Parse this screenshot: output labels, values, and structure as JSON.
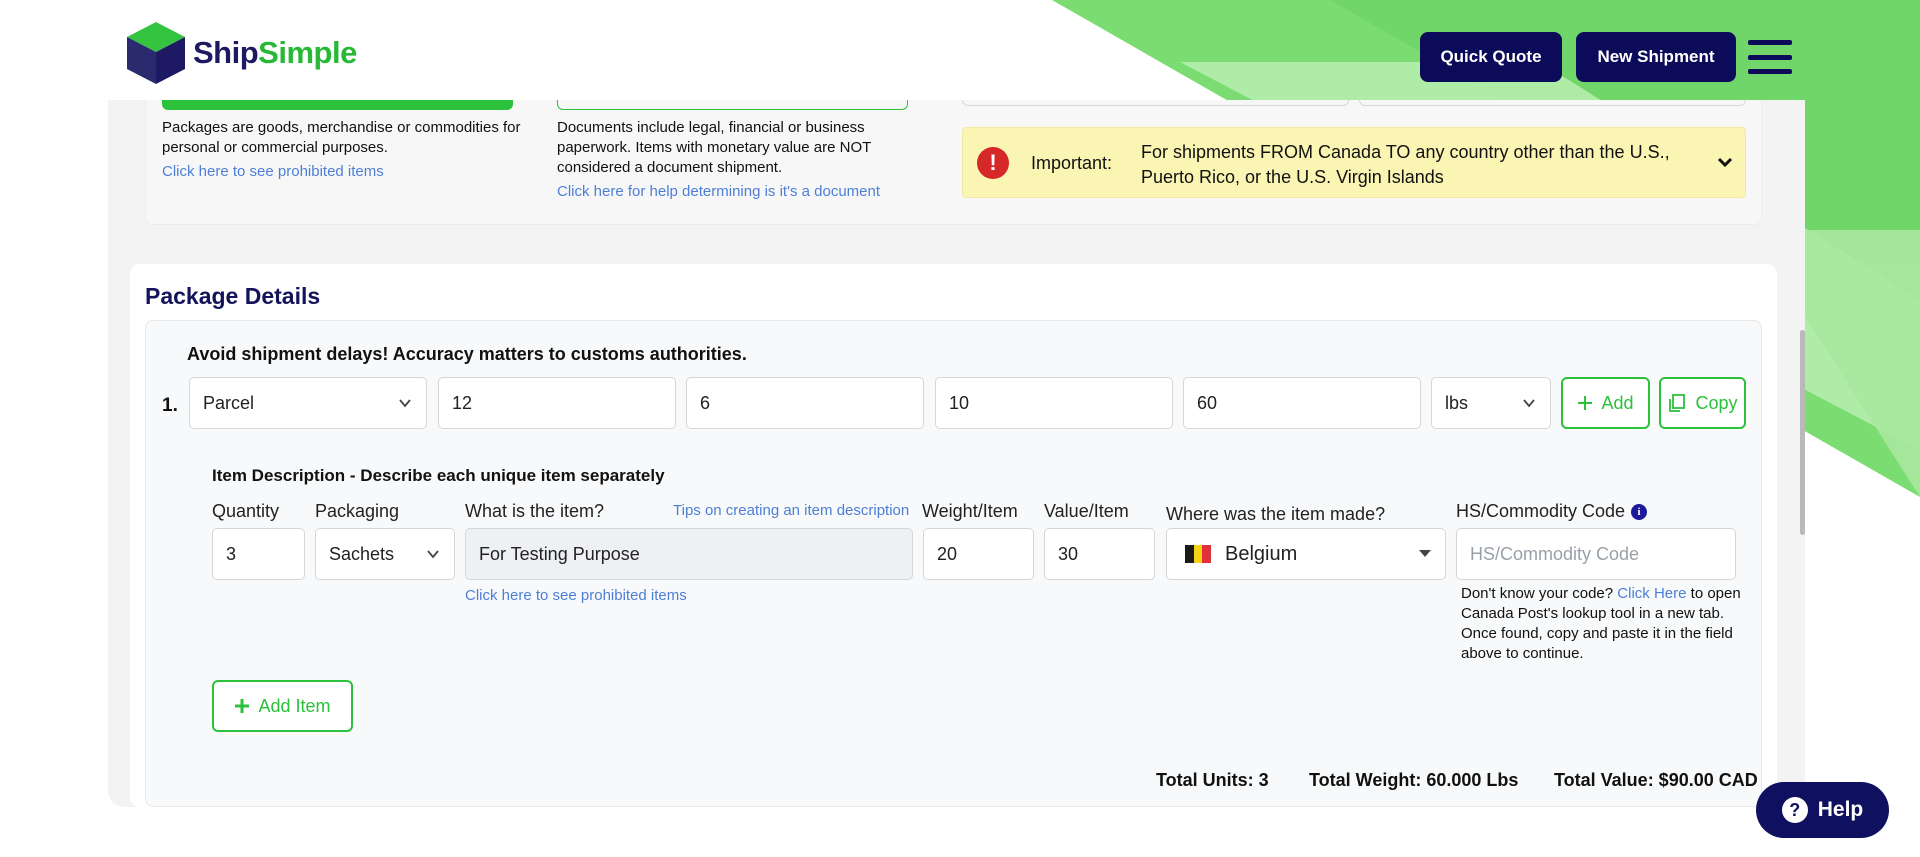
{
  "header": {
    "logo_ship": "Ship",
    "logo_simple": "Simple",
    "quick_quote": "Quick Quote",
    "new_shipment": "New Shipment"
  },
  "shipment_type": {
    "packages_desc": "Packages are goods, merchandise or commodities for personal or commercial purposes.",
    "packages_link": "Click here to see prohibited items",
    "documents_desc": "Documents include legal, financial or business paperwork. Items with monetary value are NOT considered a document shipment.",
    "documents_link": "Click here for help determining is it's a document"
  },
  "alert": {
    "label": "Important:",
    "text": "For shipments FROM Canada TO any country other than the U.S., Puerto Rico, or the U.S. Virgin Islands"
  },
  "package_details": {
    "title": "Package Details",
    "warning": "Avoid shipment delays! Accuracy matters to customs authorities.",
    "row_number": "1.",
    "package_type": "Parcel",
    "length": "12",
    "width": "6",
    "height": "10",
    "weight": "60",
    "unit": "lbs",
    "add_label": "Add",
    "copy_label": "Copy"
  },
  "item": {
    "heading": "Item Description - Describe each unique item separately",
    "labels": {
      "quantity": "Quantity",
      "packaging": "Packaging",
      "what": "What is the item?",
      "tips": "Tips on creating an item description",
      "weight_item": "Weight/Item",
      "value_item": "Value/Item",
      "made": "Where was the item made?",
      "hs": "HS/Commodity Code"
    },
    "quantity": "3",
    "packaging": "Sachets",
    "description": "For Testing Purpose",
    "weight": "20",
    "value": "30",
    "country": "Belgium",
    "hs_placeholder": "HS/Commodity Code",
    "prohibited_link": "Click here to see prohibited items",
    "hs_help_before": "Don't know your code?",
    "hs_help_link": "Click Here",
    "hs_help_after": "to open Canada Post's lookup tool in a new tab. Once found, copy and paste it in the field above to continue.",
    "add_item": "Add Item",
    "flag_colors": [
      "#1a1a1a",
      "#f5d312",
      "#e0303a"
    ]
  },
  "totals": {
    "units": "Total Units: 3",
    "weight": "Total Weight: 60.000 Lbs",
    "value": "Total Value: $90.00 CAD"
  },
  "help": {
    "label": "Help"
  },
  "colors": {
    "brand_navy": "#0b0b5a",
    "brand_green": "#2bc13b",
    "link_blue": "#4d7fd6",
    "alert_bg": "#fbf5b4"
  }
}
